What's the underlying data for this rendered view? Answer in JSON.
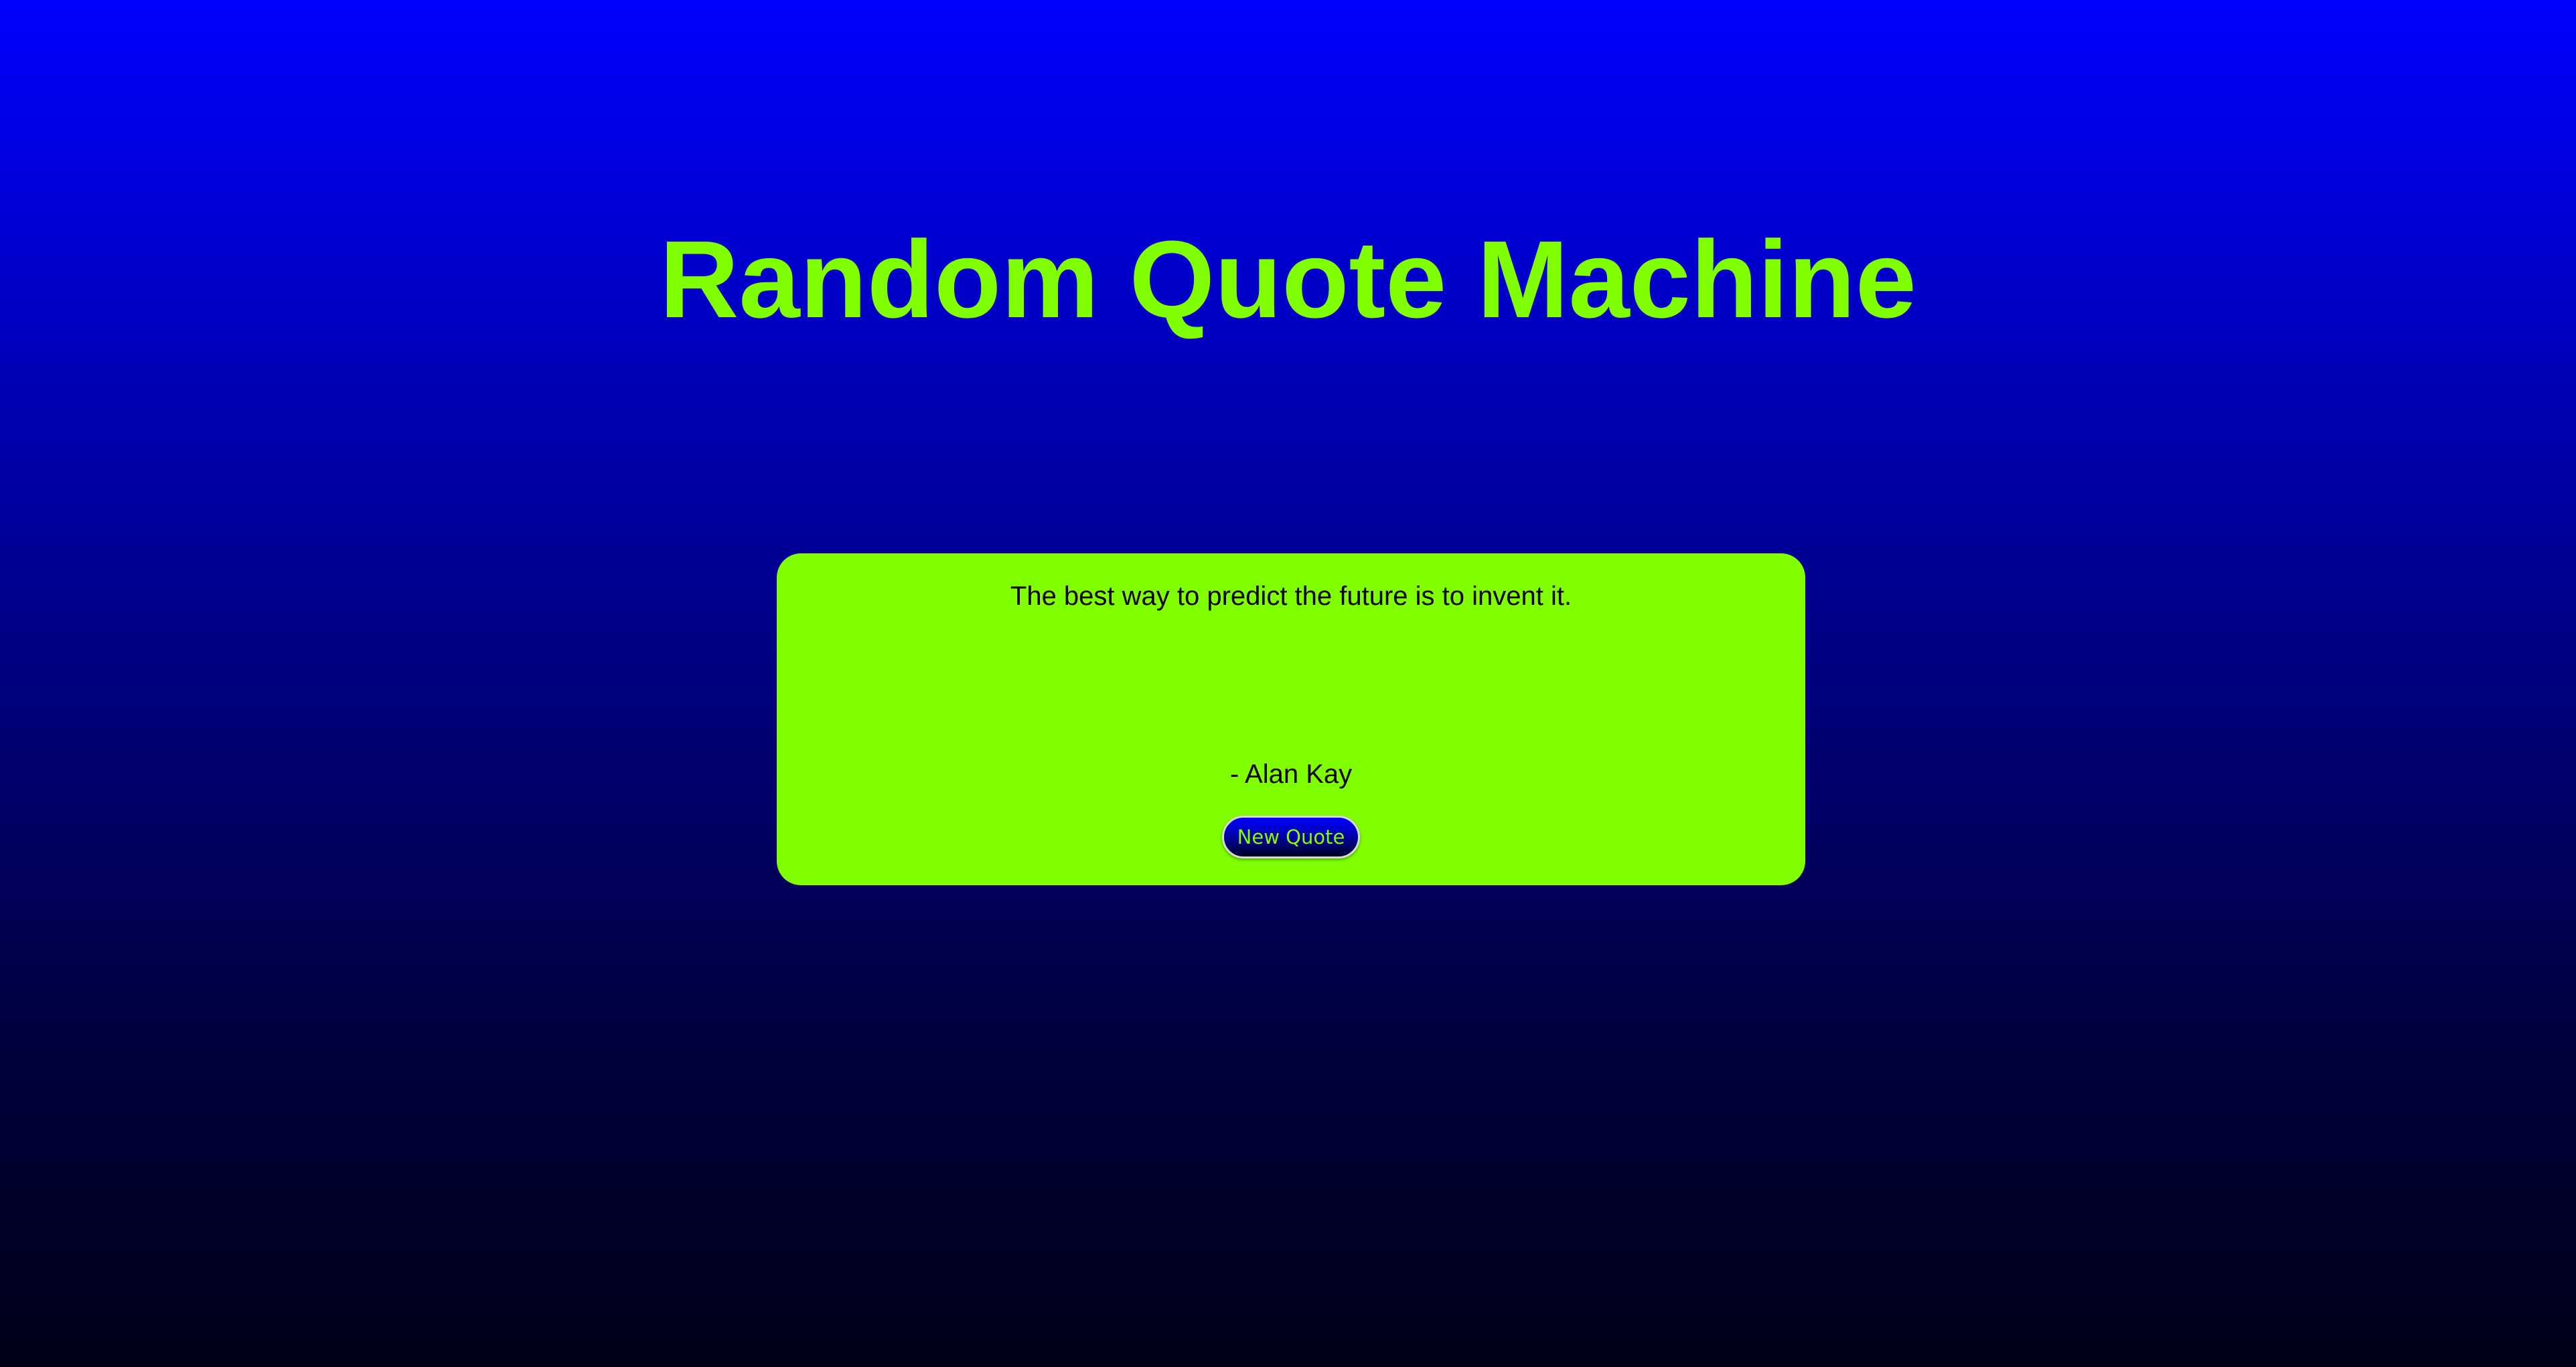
{
  "header": {
    "title": "Random Quote Machine"
  },
  "quote": {
    "text": "The best way to predict the future is to invent it.",
    "author": "- Alan Kay"
  },
  "actions": {
    "new_quote_label": "New Quote"
  },
  "colors": {
    "accent": "#7fff00",
    "background_top": "#0000ff",
    "background_bottom": "#000018",
    "text": "#000000"
  }
}
